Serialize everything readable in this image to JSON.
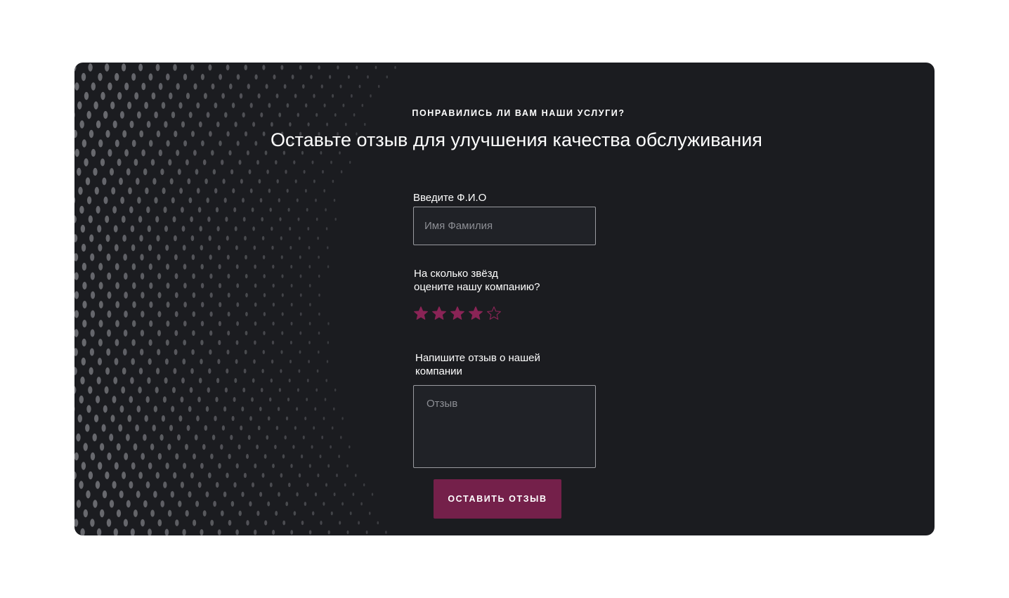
{
  "header": {
    "eyebrow": "ПОНРАВИЛИСЬ ЛИ ВАМ НАШИ УСЛУГИ?",
    "title": "Оставьте отзыв для улучшения качества обслуживания"
  },
  "form": {
    "name_label": "Введите Ф.И.О",
    "name_placeholder": "Имя Фамилия",
    "name_value": "",
    "rating_label_line1": "На сколько звёзд",
    "rating_label_line2": "оцените нашу компанию?",
    "rating": {
      "value": 4,
      "max": 5
    },
    "review_label_line1": "Напишите отзыв о нашей",
    "review_label_line2": "компании",
    "review_placeholder": "Отзыв",
    "review_value": "",
    "submit_label": "ОСТАВИТЬ ОТЗЫВ"
  },
  "colors": {
    "background": "#1b1c20",
    "accent": "#74204a",
    "star": "#8a2456",
    "input_bg": "#202227",
    "dots": "#6d6e73"
  },
  "icons": {
    "star_filled": "star-filled-icon",
    "star_empty": "star-empty-icon"
  }
}
